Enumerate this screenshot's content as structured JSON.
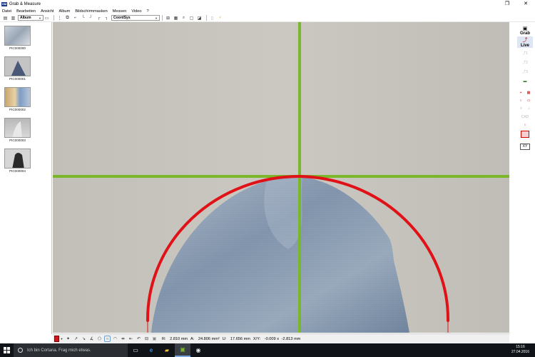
{
  "window": {
    "title": "Grab & Measure",
    "app_icon_text": "GM",
    "controls": {
      "restore": "❐",
      "close": "✕"
    }
  },
  "menu": [
    "Datei",
    "Bearbeiten",
    "Ansicht",
    "Album",
    "Bildschirmmasken",
    "Messen",
    "Video",
    "?"
  ],
  "toolbar": {
    "album_combo": "Album",
    "coord_combo": "CoordSys"
  },
  "thumbnails": [
    {
      "label": "PIC000000"
    },
    {
      "label": "PIC000001"
    },
    {
      "label": "PIC000002"
    },
    {
      "label": "PIC000003"
    },
    {
      "label": "PIC000004"
    }
  ],
  "right_panel": {
    "grab_label": "Grab",
    "live_label": "Live",
    "slot_labels": [
      "1",
      "2",
      "3"
    ],
    "cad_label": "CAD"
  },
  "status": {
    "radius_label": "R:",
    "radius_value": "2.810",
    "radius_unit": "mm",
    "area_label": "A:",
    "area_value": "24.806",
    "area_unit": "mm²",
    "perimeter_label": "U:",
    "perimeter_value": "17.656",
    "perimeter_unit": "mm",
    "xy_label": "X/Y:",
    "x_value": "-0.009",
    "x_unit": "x",
    "y_value": "-2.813",
    "y_unit": "mm"
  },
  "taskbar": {
    "search_placeholder": "Ich bin Cortana. Frag mich etwas.",
    "time": "15:16",
    "date": "27.04.2016"
  },
  "colors": {
    "crosshair": "#7ab829",
    "measure_arc": "#e01218",
    "background_surface": "#c6c3bd",
    "metal_surface": "#8fa0b5"
  }
}
